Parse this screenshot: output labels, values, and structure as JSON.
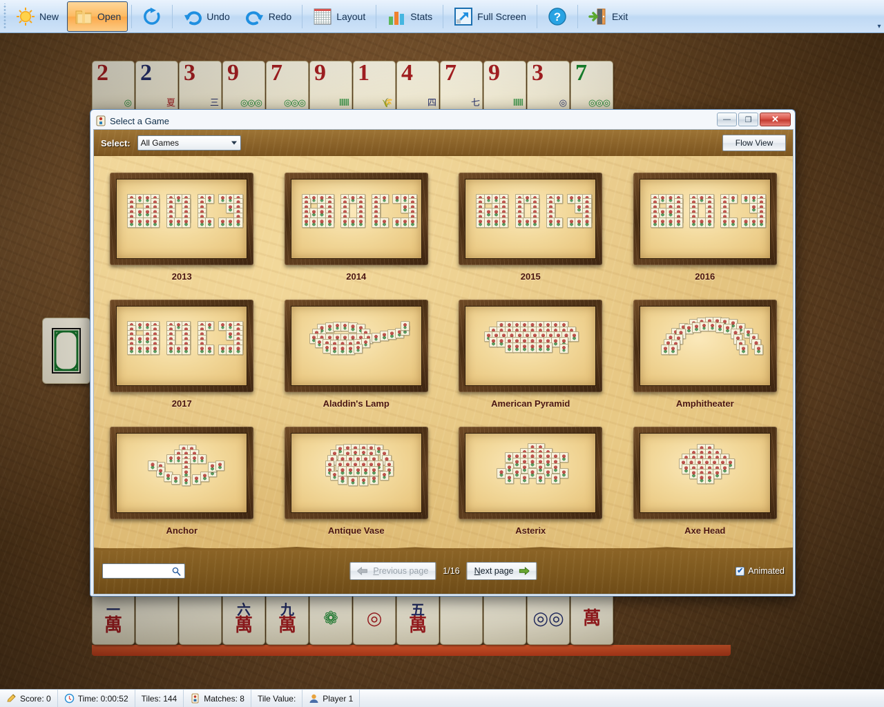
{
  "toolbar": {
    "buttons": [
      {
        "label": "New",
        "icon": "sun-icon",
        "active": false
      },
      {
        "label": "Open",
        "icon": "folder-icon",
        "active": true
      },
      {
        "label": "",
        "icon": "restart-icon",
        "active": false
      },
      {
        "label": "Undo",
        "icon": "undo-arrow-icon",
        "active": false
      },
      {
        "label": "Redo",
        "icon": "redo-arrow-icon",
        "active": false
      },
      {
        "label": "Layout",
        "icon": "grid-layout-icon",
        "active": false
      },
      {
        "label": "Stats",
        "icon": "bar-chart-icon",
        "active": false
      },
      {
        "label": "Full Screen",
        "icon": "expand-arrow-icon",
        "active": false
      },
      {
        "label": "",
        "icon": "help-question-icon",
        "active": false
      },
      {
        "label": "Exit",
        "icon": "exit-door-icon",
        "active": false
      }
    ],
    "overflow_glyph": "▾"
  },
  "dialog": {
    "title": "Select a Game",
    "icon": "game-tile-icon",
    "window_controls": {
      "minimize": "—",
      "maximize": "❐",
      "close": "✕"
    },
    "filter": {
      "label": "Select:",
      "selected": "All Games",
      "options": [
        "All Games"
      ],
      "flow_view_label": "Flow View"
    },
    "games": [
      {
        "name": "2013",
        "shape": "digits"
      },
      {
        "name": "2014",
        "shape": "digits"
      },
      {
        "name": "2015",
        "shape": "digits"
      },
      {
        "name": "2016",
        "shape": "digits"
      },
      {
        "name": "2017",
        "shape": "digits"
      },
      {
        "name": "Aladdin's Lamp",
        "shape": "lamp"
      },
      {
        "name": "American Pyramid",
        "shape": "pyramid"
      },
      {
        "name": "Amphitheater",
        "shape": "arch"
      },
      {
        "name": "Anchor",
        "shape": "anchor"
      },
      {
        "name": "Antique Vase",
        "shape": "vase"
      },
      {
        "name": "Asterix",
        "shape": "star"
      },
      {
        "name": "Axe Head",
        "shape": "axe"
      }
    ],
    "bottom": {
      "search_value": "",
      "search_placeholder": "",
      "search_icon": "magnifier-icon",
      "previous_page_label": "Previous page",
      "previous_page_accel": "P",
      "previous_page_enabled": false,
      "next_page_label": "Next page",
      "next_page_accel": "N",
      "next_page_enabled": true,
      "page_indicator": "1/16",
      "animated_label": "Animated",
      "animated_checked": true,
      "checkmark": "✔"
    }
  },
  "board": {
    "top_tiles": [
      {
        "num": "2",
        "num_color": "red",
        "sym": "◎",
        "sym_color": "green"
      },
      {
        "num": "2",
        "num_color": "blue",
        "sym": "夏",
        "sym_color": "red"
      },
      {
        "num": "3",
        "num_color": "red",
        "sym": "三",
        "sym_color": "blue"
      },
      {
        "num": "9",
        "num_color": "red",
        "sym": "◎◎◎",
        "sym_color": "green"
      },
      {
        "num": "7",
        "num_color": "red",
        "sym": "◎◎◎",
        "sym_color": "green"
      },
      {
        "num": "9",
        "num_color": "red",
        "sym": "⦀⦀⦀",
        "sym_color": "green"
      },
      {
        "num": "1",
        "num_color": "red",
        "sym": "🌾",
        "sym_color": "green"
      },
      {
        "num": "4",
        "num_color": "red",
        "sym": "四",
        "sym_color": "blue"
      },
      {
        "num": "7",
        "num_color": "red",
        "sym": "七",
        "sym_color": "blue"
      },
      {
        "num": "9",
        "num_color": "red",
        "sym": "⦀⦀⦀",
        "sym_color": "green"
      },
      {
        "num": "3",
        "num_color": "red",
        "sym": "◎",
        "sym_color": "blue"
      },
      {
        "num": "7",
        "num_color": "green",
        "sym": "◎◎◎",
        "sym_color": "green"
      }
    ],
    "bottom_tiles": [
      {
        "top": "一",
        "bottom": "萬",
        "top_color": "blue",
        "bottom_color": "red"
      },
      {
        "top": "",
        "bottom": "",
        "top_color": "green",
        "bottom_color": "green"
      },
      {
        "top": "",
        "bottom": "",
        "top_color": "green",
        "bottom_color": "green"
      },
      {
        "top": "六",
        "bottom": "萬",
        "top_color": "blue",
        "bottom_color": "red"
      },
      {
        "top": "九",
        "bottom": "萬",
        "top_color": "blue",
        "bottom_color": "red"
      },
      {
        "top": "",
        "bottom": "❁",
        "top_color": "green",
        "bottom_color": "green"
      },
      {
        "top": "",
        "bottom": "◎",
        "top_color": "red",
        "bottom_color": "red"
      },
      {
        "top": "五",
        "bottom": "萬",
        "top_color": "blue",
        "bottom_color": "red"
      },
      {
        "top": "",
        "bottom": "",
        "top_color": "green",
        "bottom_color": "green"
      },
      {
        "top": "",
        "bottom": "",
        "top_color": "green",
        "bottom_color": "green"
      },
      {
        "top": "",
        "bottom": "◎◎",
        "top_color": "blue",
        "bottom_color": "blue"
      },
      {
        "top": "",
        "bottom": "萬",
        "top_color": "red",
        "bottom_color": "red"
      }
    ],
    "left_tile_icon": "white-dragon-tile",
    "right_tile_icon": "flower-bird-tile"
  },
  "statusbar": {
    "cells": [
      {
        "icon": "pencil-icon",
        "text": "Score: 0"
      },
      {
        "icon": "clock-icon",
        "text": "Time: 0:00:52"
      },
      {
        "icon": "",
        "text": "Tiles: 144"
      },
      {
        "icon": "tile-icon",
        "text": "Matches: 8"
      },
      {
        "icon": "",
        "text": "Tile Value:"
      },
      {
        "icon": "player-icon",
        "text": "Player 1"
      }
    ]
  },
  "colors": {
    "accent_blue": "#2a4d78",
    "tile_red": "#a81f22",
    "tile_green": "#18862f",
    "tile_blue": "#26306b",
    "wood_brown": "#6e4b17",
    "parchment": "#e5c583",
    "highlight_orange": "#fba94a"
  }
}
